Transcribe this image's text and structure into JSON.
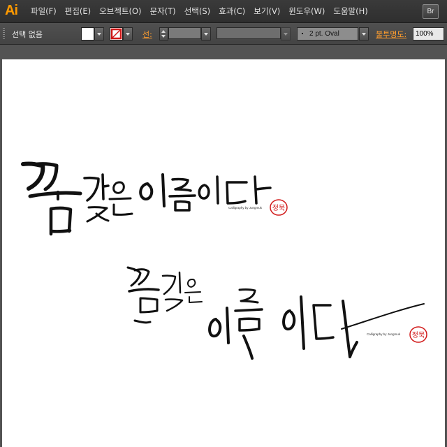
{
  "app": {
    "logo": "Ai",
    "bridge_button": "Br"
  },
  "menu": [
    {
      "label": "파일(F)"
    },
    {
      "label": "편집(E)"
    },
    {
      "label": "오브젝트(O)"
    },
    {
      "label": "문자(T)"
    },
    {
      "label": "선택(S)"
    },
    {
      "label": "효과(C)"
    },
    {
      "label": "보기(V)"
    },
    {
      "label": "윈도우(W)"
    },
    {
      "label": "도움말(H)"
    }
  ],
  "control_bar": {
    "selection_status": "선택 없음",
    "fill_color": "#ffffff",
    "stroke_label": "선:",
    "brush_definition": "2 pt. Oval",
    "opacity_label": "불투명도:",
    "opacity_value": "100%"
  },
  "canvas": {
    "background": "#ffffff",
    "artwork_1": {
      "credit": "Calligraphy by Jungmuk",
      "seal": "정묵"
    },
    "artwork_2": {
      "credit": "Calligraphy by Jungmuk",
      "seal": "정묵"
    }
  },
  "colors": {
    "accent": "#ff9a00",
    "label_orange": "#ff9d2e",
    "seal_red": "#d11a1a"
  }
}
